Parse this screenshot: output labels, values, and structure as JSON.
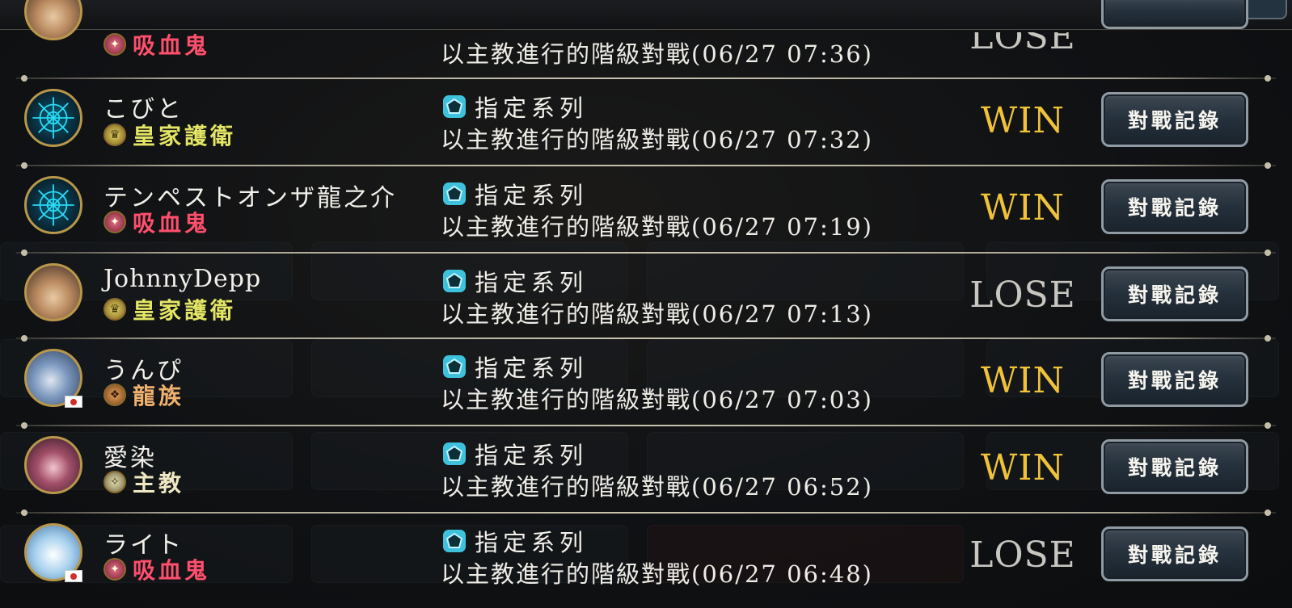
{
  "format_icon_color": "#7ad7ea",
  "colors": {
    "win": "#f0c23a",
    "lose": "#c8c6c0"
  },
  "rows": [
    {
      "player_name": "",
      "class_label": "吸血鬼",
      "class_type": "vampire",
      "format_label": "",
      "match_desc": "以主教進行的階級對戰(06/27 07:36)",
      "result": "LOSE",
      "button": ""
    },
    {
      "player_name": "こびと",
      "class_label": "皇家護衛",
      "class_type": "royal",
      "avatar_icon": "emblem-icon",
      "format_label": "指定系列",
      "match_desc": "以主教進行的階級對戰(06/27 07:32)",
      "result": "WIN",
      "button": "對戰記錄"
    },
    {
      "player_name": "テンペストオンザ龍之介",
      "class_label": "吸血鬼",
      "class_type": "vampire",
      "avatar_icon": "emblem-icon",
      "format_label": "指定系列",
      "match_desc": "以主教進行的階級對戰(06/27 07:19)",
      "result": "WIN",
      "button": "對戰記錄"
    },
    {
      "player_name": "JohnnyDepp",
      "class_label": "皇家護衛",
      "class_type": "royal",
      "avatar_icon": "character-portrait",
      "format_label": "指定系列",
      "match_desc": "以主教進行的階級對戰(06/27 07:13)",
      "result": "LOSE",
      "button": "對戰記錄"
    },
    {
      "player_name": "うんぴ",
      "class_label": "龍族",
      "class_type": "dragon",
      "avatar_icon": "character-portrait",
      "flag": "japan-flag-icon",
      "format_label": "指定系列",
      "match_desc": "以主教進行的階級對戰(06/27 07:03)",
      "result": "WIN",
      "button": "對戰記錄"
    },
    {
      "player_name": "愛染",
      "class_label": "主教",
      "class_type": "bishop",
      "avatar_icon": "character-portrait",
      "format_label": "指定系列",
      "match_desc": "以主教進行的階級對戰(06/27 06:52)",
      "result": "WIN",
      "button": "對戰記錄"
    },
    {
      "player_name": "ライト",
      "class_label": "吸血鬼",
      "class_type": "vampire",
      "avatar_icon": "character-portrait",
      "flag": "japan-flag-icon",
      "format_label": "指定系列",
      "match_desc": "以主教進行的階級對戰(06/27 06:48)",
      "result": "LOSE",
      "button": "對戰記錄"
    }
  ]
}
